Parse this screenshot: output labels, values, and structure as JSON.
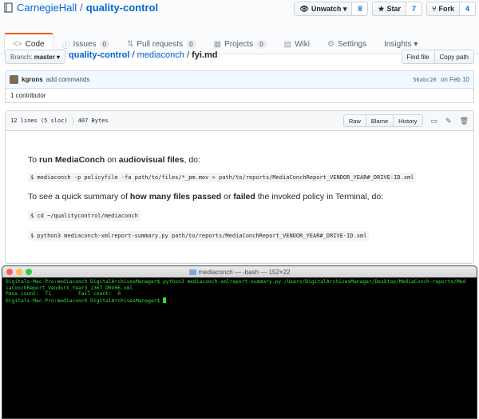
{
  "repo": {
    "owner": "CarnegieHall",
    "separator": "/",
    "name": "quality-control"
  },
  "actions": [
    {
      "label": "Unwatch ▾",
      "count": "8",
      "icon": "eye-icon",
      "glyph": "👁"
    },
    {
      "label": "Star",
      "count": "7",
      "icon": "star-icon",
      "glyph": "★"
    },
    {
      "label": "Fork",
      "count": "4",
      "icon": "fork-icon",
      "glyph": "⑂"
    }
  ],
  "tabs": [
    {
      "label": "Code",
      "icon": "code-icon",
      "glyph": "<>",
      "badge": ""
    },
    {
      "label": "Issues",
      "icon": "issue-icon",
      "glyph": "ⓘ",
      "badge": "0"
    },
    {
      "label": "Pull requests",
      "icon": "pull-request-icon",
      "glyph": "⇅",
      "badge": "0"
    },
    {
      "label": "Projects",
      "icon": "project-icon",
      "glyph": "▦",
      "badge": "0"
    },
    {
      "label": "Wiki",
      "icon": "book-icon",
      "glyph": "▤",
      "badge": ""
    },
    {
      "label": "Settings",
      "icon": "gear-icon",
      "glyph": "⚙",
      "badge": ""
    },
    {
      "label": "Insights ▾",
      "icon": "",
      "glyph": "",
      "badge": ""
    }
  ],
  "branch": {
    "prefix": "Branch:",
    "name": "master ▾"
  },
  "breadcrumb": {
    "repo": "quality-control",
    "sep1": " / ",
    "folder": "mediaconch",
    "sep2": " / ",
    "file": "fyi.md"
  },
  "path_buttons": {
    "find": "Find file",
    "copy": "Copy path"
  },
  "commit": {
    "user": "kgrons",
    "message": "add commands",
    "sha": "56abc20",
    "date": "on Feb 10"
  },
  "contributors": "1 contributor",
  "file_header": {
    "lines": "12 lines (5 sloc)",
    "size": "407 Bytes",
    "raw": "Raw",
    "blame": "Blame",
    "history": "History"
  },
  "readme": {
    "p1_a": "To ",
    "p1_b": "run MediaConch",
    "p1_c": " on ",
    "p1_d": "audiovisual files",
    "p1_e": ", do:",
    "code1": "$ mediaconch -p policyfile -fa path/to/files/*_pm.mov > path/to/reports/MediaConchReport_VENDOR_YEAR#_DRIVE-ID.xml",
    "p2_a": "To see a quick summary of ",
    "p2_b": "how many files passed",
    "p2_c": " or ",
    "p2_d": "failed",
    "p2_e": " the invoked policy in Terminal, do:",
    "code2": "$ cd ~/qualitycontrol/mediaconch",
    "code3": "$ python3 mediaconch-xmlreport-summary.py path/to/reports/MediaConchReport_VENDOR_YEAR#_DRIVE-ID.xml"
  },
  "terminal": {
    "title": "mediaconch — -bash — 152×22",
    "line1": "Digitals-Mac-Pro:mediaconch DigitalArchivesManager$ python3 mediaconch-xmlreport-summary.py /Users/DigitalArchivesManager/Desktop/MediaConch-reports/Med",
    "line2": "iaConchReport_VendorX_Year3_1367_DRV06.xml",
    "line3": "Pass count:  71         Fail count:  0",
    "line4": "Digitals-Mac-Pro:mediaconch DigitalArchivesManager$ "
  },
  "colors": {
    "link": "#0366d6",
    "tab_accent": "#e36209",
    "terminal_text": "#30e030"
  }
}
